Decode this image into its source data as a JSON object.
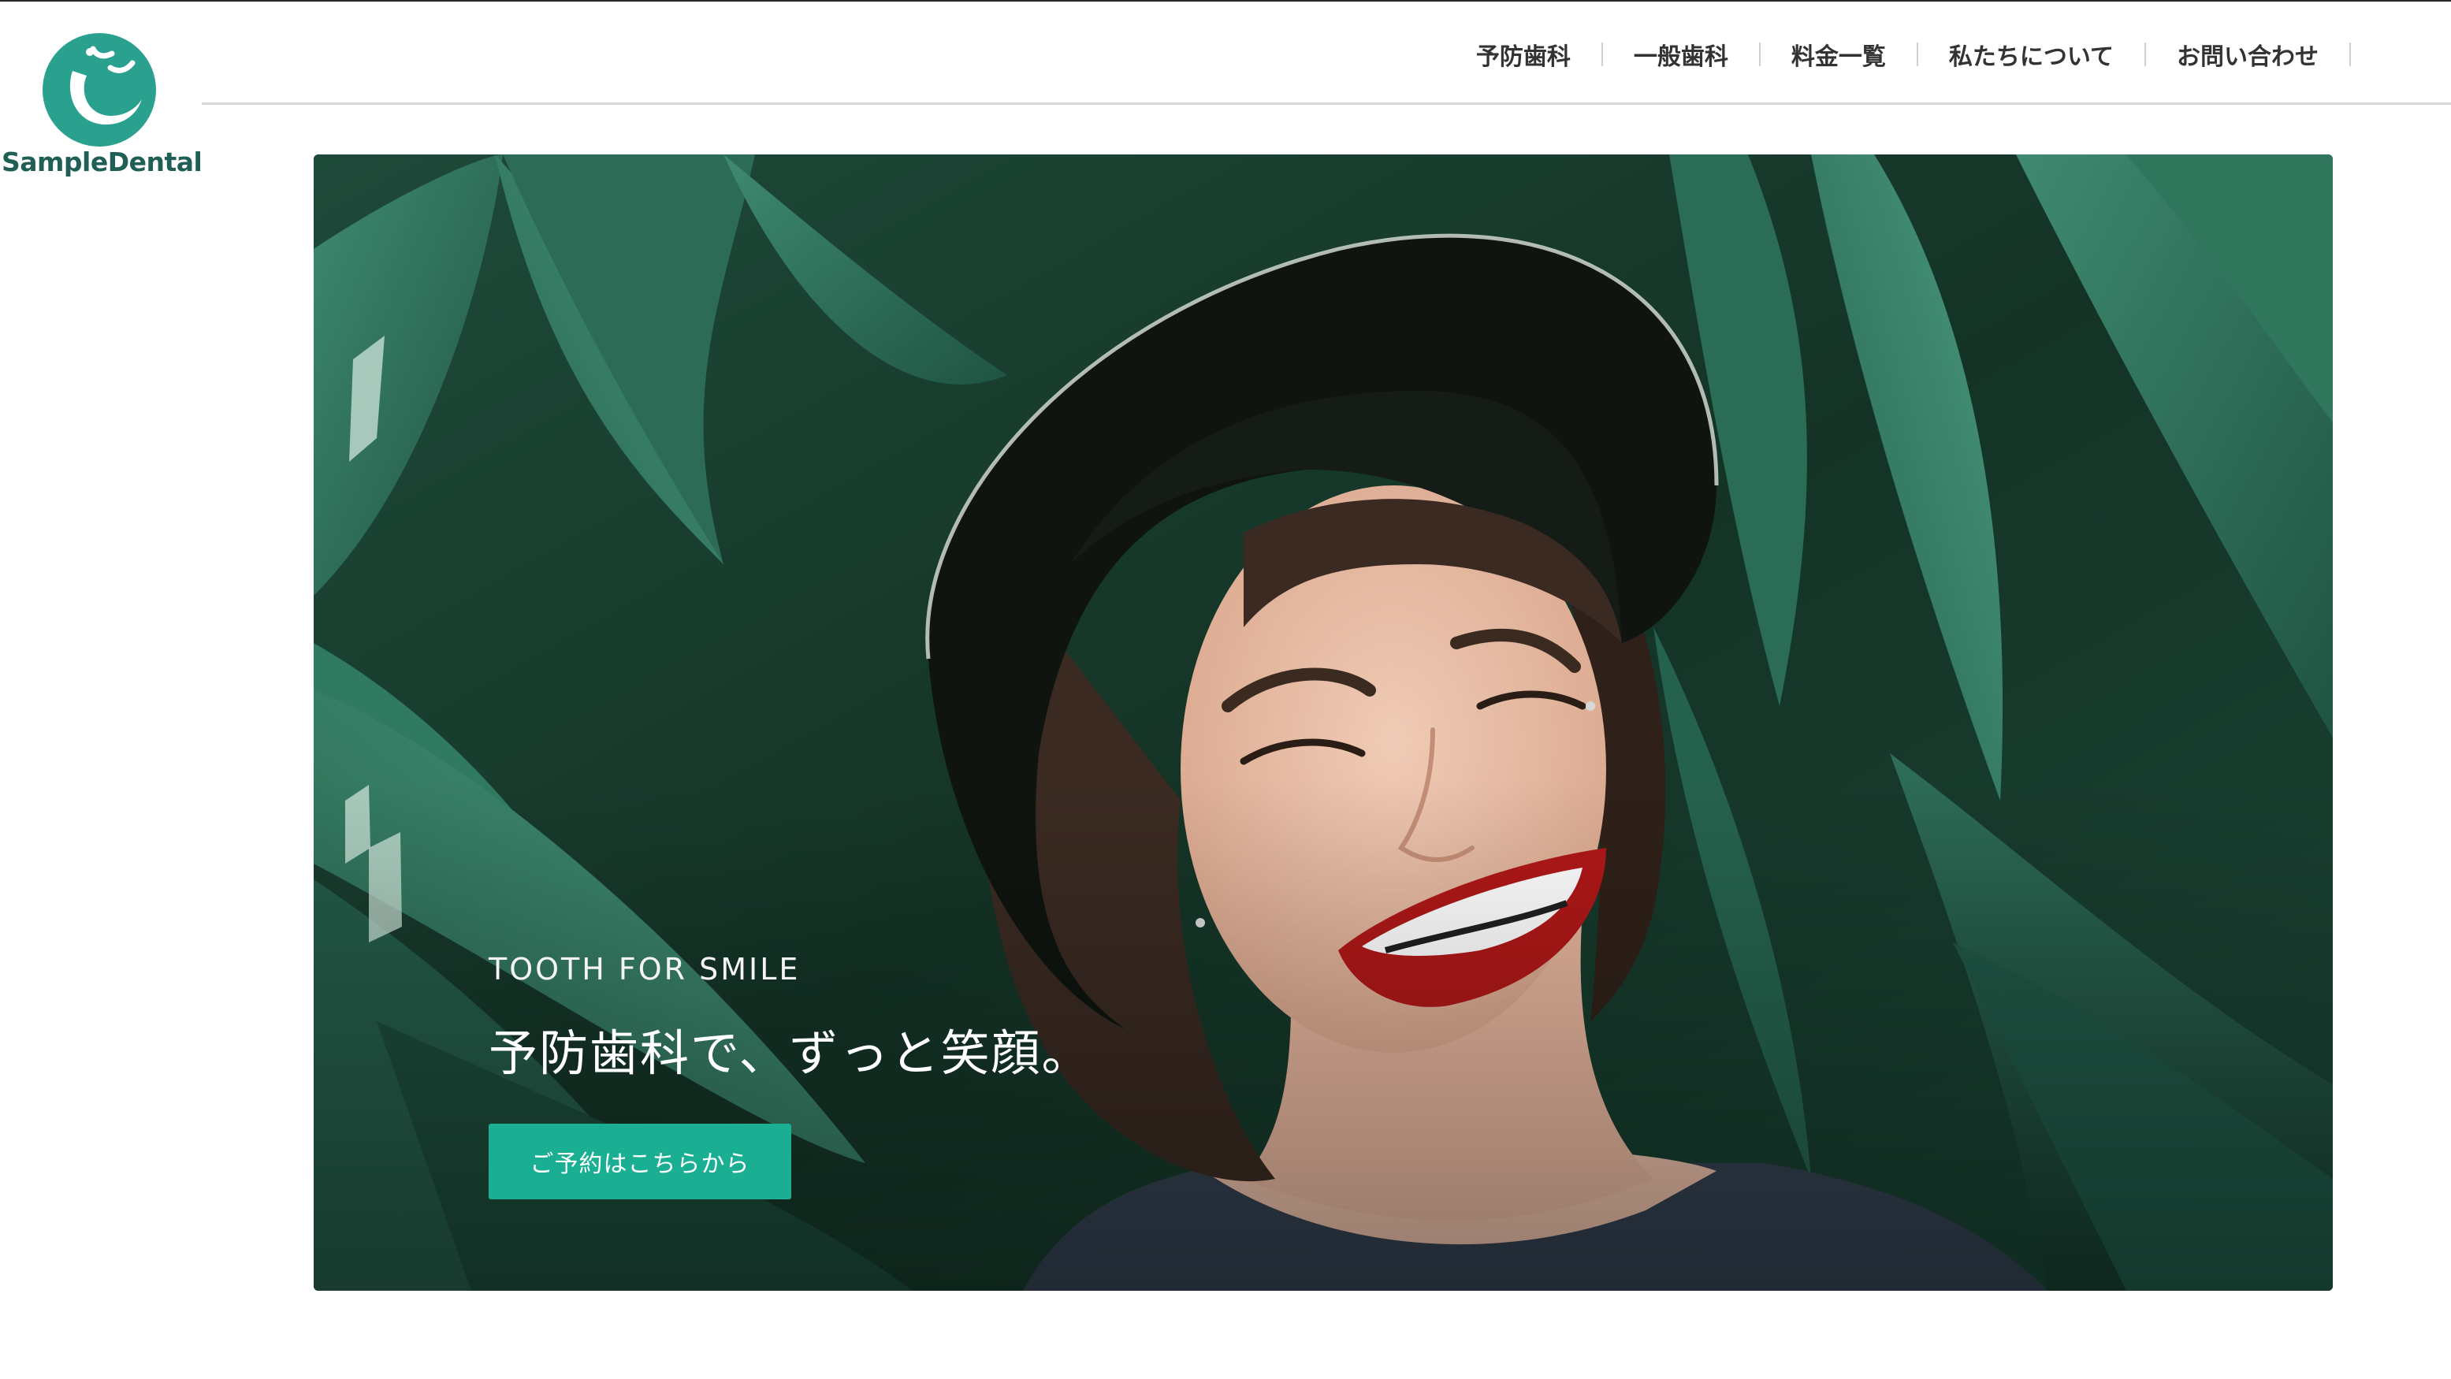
{
  "brand": {
    "name": "SampleDental",
    "color": "#2aa18e",
    "text_color": "#1f5f55"
  },
  "nav": {
    "items": [
      {
        "label": "予防歯科"
      },
      {
        "label": "一般歯科"
      },
      {
        "label": "料金一覧"
      },
      {
        "label": "私たちについて"
      },
      {
        "label": "お問い合わせ"
      }
    ]
  },
  "hero": {
    "subtitle": "TOOTH FOR SMILE",
    "title": "予防歯科で、ずっと笑顔。",
    "cta_label": "ご予約はこちらから",
    "cta_color": "#1aae93"
  }
}
